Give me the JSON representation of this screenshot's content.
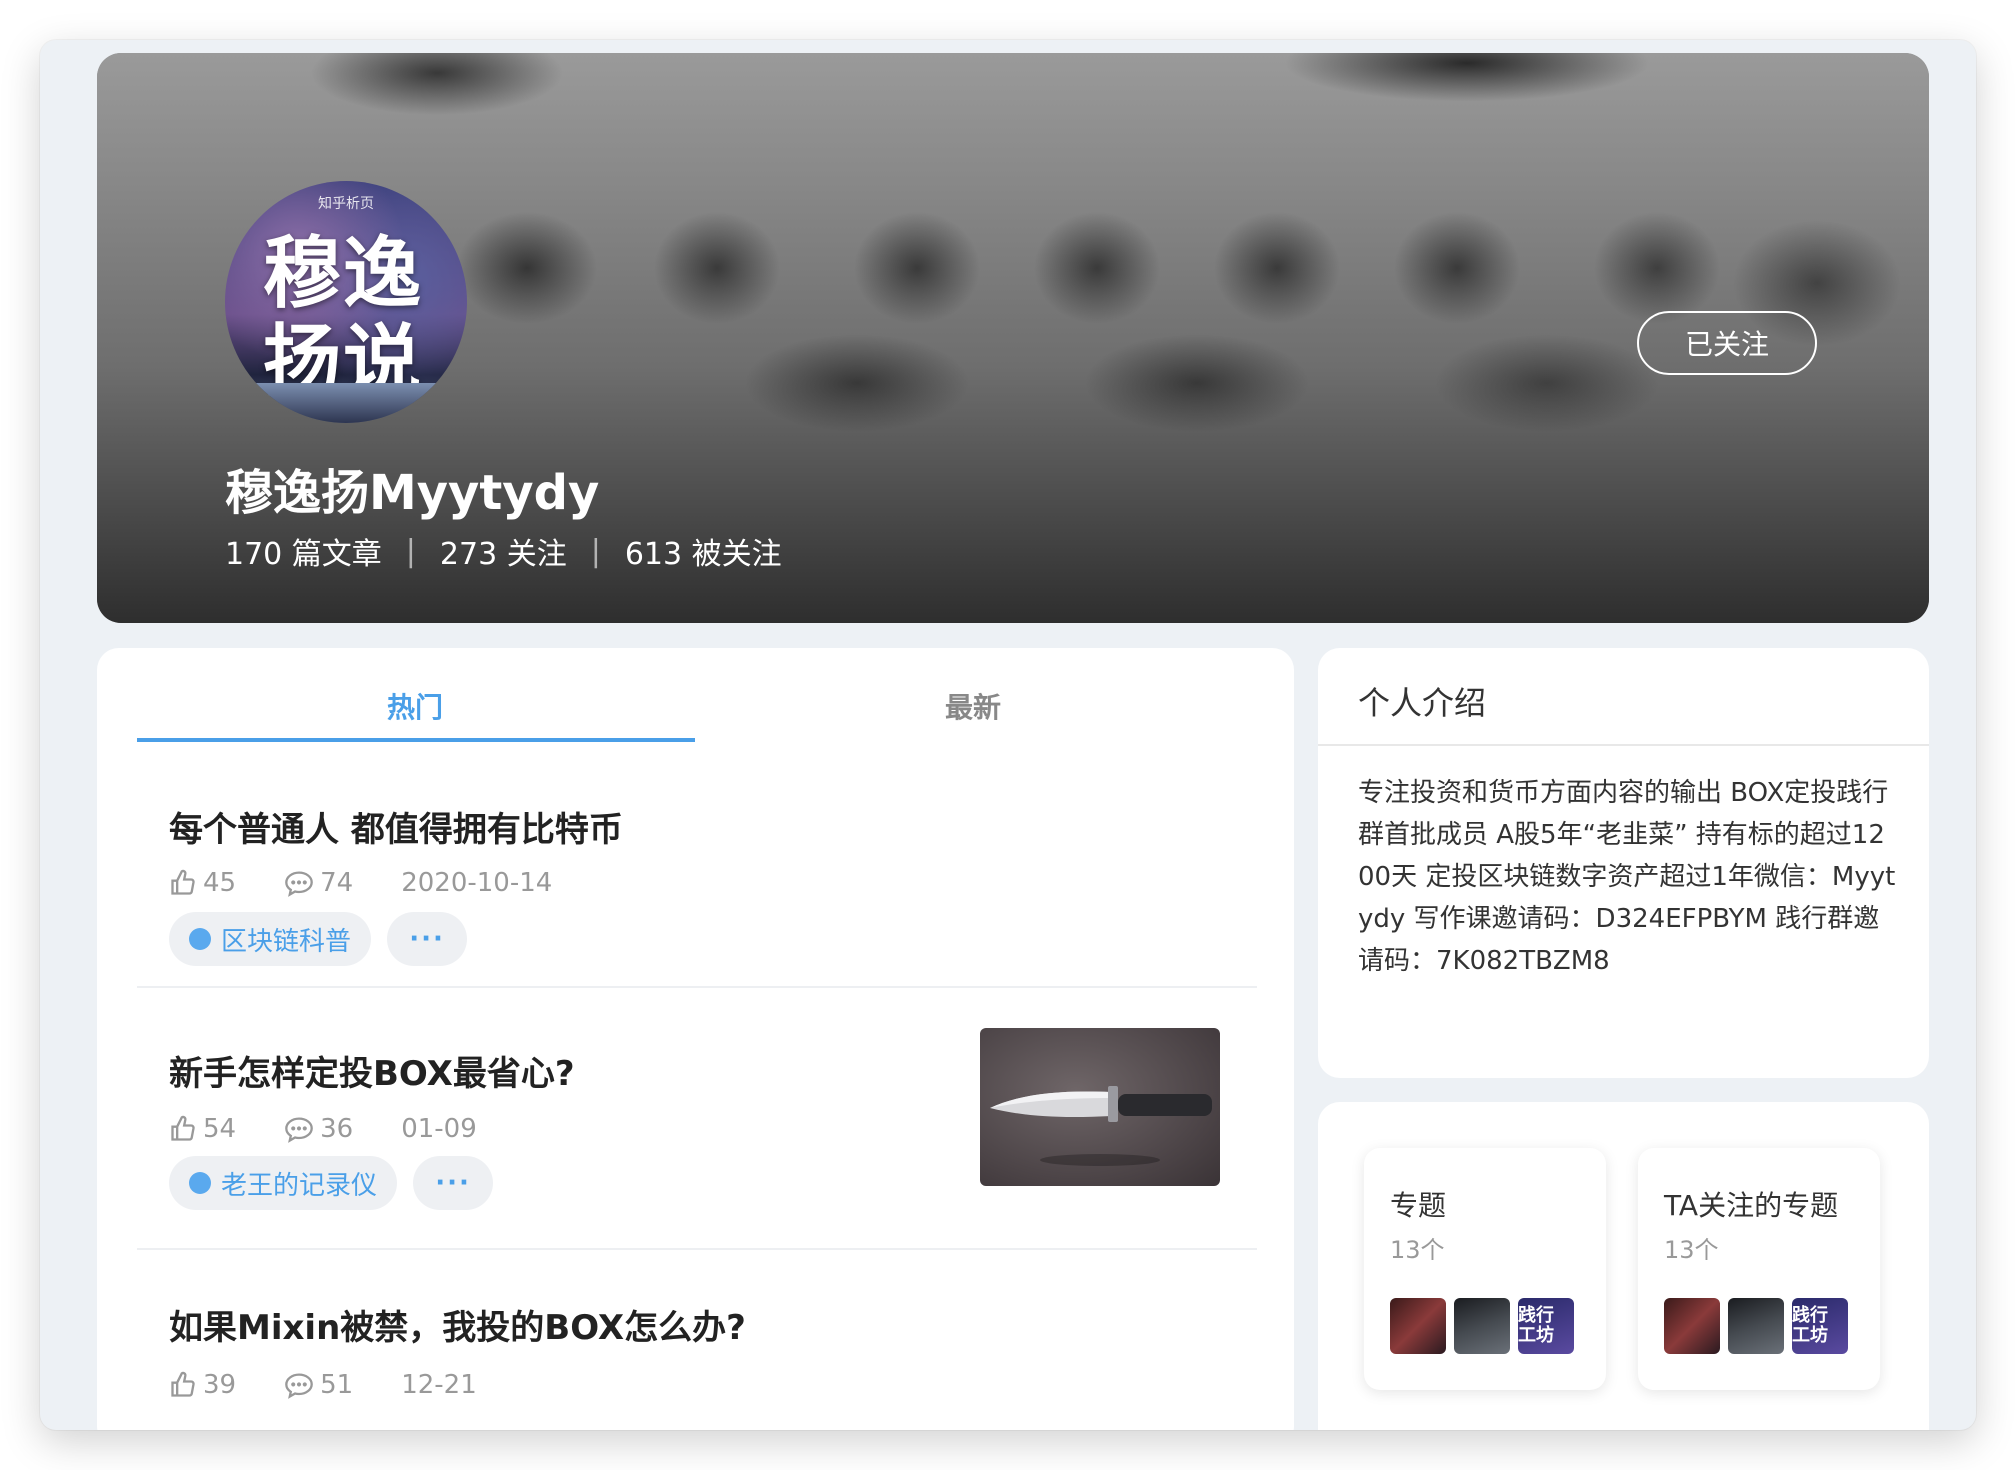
{
  "profile": {
    "avatar_brand": "知乎析页",
    "avatar_line1": "穆逸",
    "avatar_line2": "扬说",
    "name": "穆逸扬Myytydy",
    "articles": "170 篇文章",
    "following": "273 关注",
    "followers": "613 被关注",
    "separator": "|",
    "follow_button": "已关注"
  },
  "tabs": [
    {
      "label": "热门",
      "active": true
    },
    {
      "label": "最新",
      "active": false
    }
  ],
  "articles": [
    {
      "title": "每个普通人 都值得拥有比特币",
      "likes": "45",
      "comments": "74",
      "date": "2020-10-14",
      "tag": "区块链科普",
      "more": "···",
      "has_thumbnail": false
    },
    {
      "title": "新手怎样定投BOX最省心?",
      "likes": "54",
      "comments": "36",
      "date": "01-09",
      "tag": "老王的记录仪",
      "more": "···",
      "has_thumbnail": true
    },
    {
      "title": "如果Mixin被禁，我投的BOX怎么办?",
      "likes": "39",
      "comments": "51",
      "date": "12-21",
      "has_thumbnail": false
    }
  ],
  "intro": {
    "title": "个人介绍",
    "text": "专注投资和货币方面内容的输出 BOX定投践行群首批成员 A股5年“老韭菜” 持有标的超过1200天 定投区块链数字资产超过1年微信：Myytydy 写作课邀请码：D324EFPBYM 践行群邀请码：7K082TBZM8"
  },
  "topics": [
    {
      "title": "专题",
      "count": "13个",
      "mini_label": "践行 工坊"
    },
    {
      "title": "TA关注的专题",
      "count": "13个",
      "mini_label": "践行 工坊"
    }
  ],
  "colors": {
    "accent": "#4a9fe8",
    "page_bg": "#edf1f5"
  },
  "icons": [
    "thumbs-up-icon",
    "comment-icon"
  ]
}
